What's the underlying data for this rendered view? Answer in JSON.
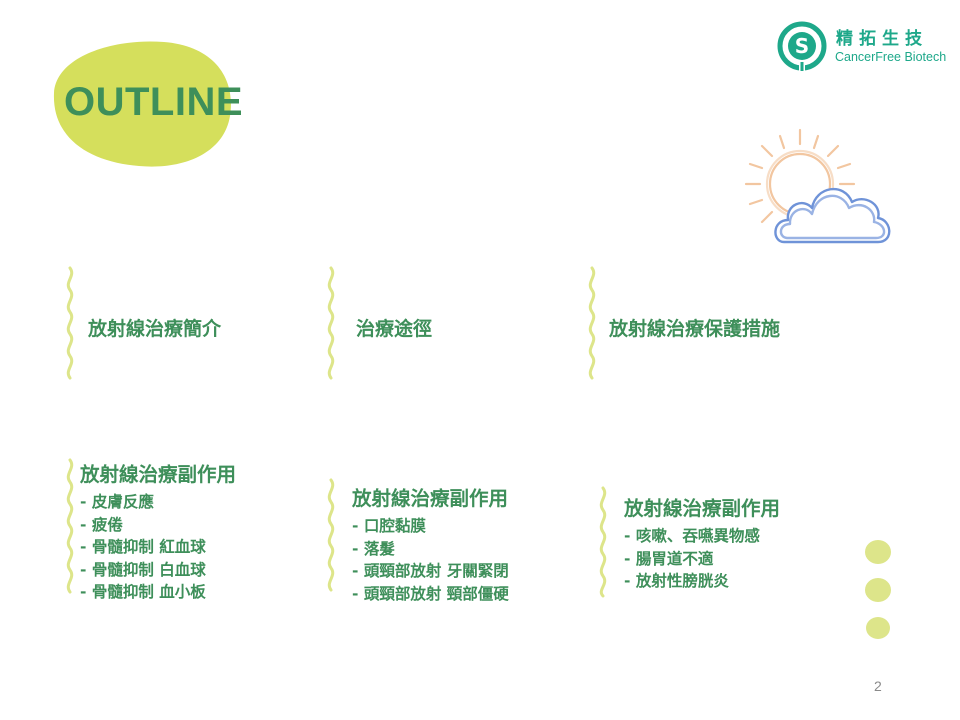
{
  "slide": {
    "title": "OUTLINE",
    "page_number": "2"
  },
  "logo": {
    "name_cn": "精拓生技",
    "name_en": "CancerFree Biotech"
  },
  "colors": {
    "title_green": "#3e8f5a",
    "logo_teal": "#1ea88a",
    "lime_blob": "#d5df5c",
    "dot_lime": "#dde58a",
    "sun_peach": "#f2c6a0",
    "cloud_blue": "#6f93d8"
  },
  "topics": [
    {
      "label": "放射線治療簡介"
    },
    {
      "label": "治療途徑"
    },
    {
      "label": "放射線治療保護措施"
    }
  ],
  "side_effects": [
    {
      "heading": "放射線治療副作用",
      "items": [
        "- 皮膚反應",
        "- 疲倦",
        "- 骨髓抑制 紅血球",
        "- 骨髓抑制 白血球",
        "- 骨髓抑制 血小板"
      ]
    },
    {
      "heading": "放射線治療副作用",
      "items": [
        "- 口腔黏膜",
        "- 落髮",
        "- 頭頸部放射 牙關緊閉",
        "- 頭頸部放射 頸部僵硬"
      ]
    },
    {
      "heading": "放射線治療副作用",
      "items": [
        "- 咳嗽、吞嚥異物感",
        "- 腸胃道不適",
        "- 放射性膀胱炎"
      ]
    }
  ],
  "icons": {
    "logo": "cancerfree-logo-icon",
    "weather": "sun-cloud-icon",
    "divider": "squiggle-divider-icon"
  }
}
